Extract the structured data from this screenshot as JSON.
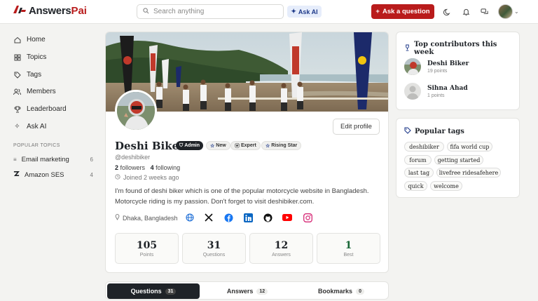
{
  "header": {
    "logo_text_1": "Answers",
    "logo_text_2": "Pai",
    "search_placeholder": "Search anything",
    "ask_ai_label": "Ask AI",
    "ask_question_label": "Ask a question",
    "ask_question_prefix": "+"
  },
  "sidebar": {
    "items": [
      {
        "label": "Home",
        "icon": "home-icon"
      },
      {
        "label": "Topics",
        "icon": "grid-icon"
      },
      {
        "label": "Tags",
        "icon": "tag-icon"
      },
      {
        "label": "Members",
        "icon": "users-icon"
      },
      {
        "label": "Leaderboard",
        "icon": "trophy-icon"
      },
      {
        "label": "Ask AI",
        "icon": "sparkle-icon"
      }
    ],
    "popular_title": "POPULAR TOPICS",
    "popular": [
      {
        "label": "Email marketing",
        "count": "6"
      },
      {
        "label": "Amazon SES",
        "count": "4"
      }
    ]
  },
  "profile": {
    "edit_label": "Edit profile",
    "name": "Deshi Biker",
    "badges": {
      "admin": "Admin",
      "new": "New",
      "expert": "Expert",
      "rising": "Rising Star"
    },
    "handle": "@deshibiker",
    "followers_count": "2",
    "followers_label": "followers",
    "following_count": "4",
    "following_label": "following",
    "joined": "Joined  2 weeks ago",
    "bio": "I'm found of deshi biker which is one of the popular motorcycle website in Bangladesh. Motorcycle riding is my passion. Don't forget to visit deshibiker.com.",
    "location": "Dhaka, Bangladesh",
    "social": [
      "globe-icon",
      "x-icon",
      "facebook-icon",
      "linkedin-icon",
      "github-icon",
      "youtube-icon",
      "instagram-icon"
    ],
    "stats": [
      {
        "value": "105",
        "label": "Points"
      },
      {
        "value": "31",
        "label": "Questions"
      },
      {
        "value": "12",
        "label": "Answers"
      },
      {
        "value": "1",
        "label": "Best"
      }
    ]
  },
  "tabs": [
    {
      "label": "Questions",
      "count": "31"
    },
    {
      "label": "Answers",
      "count": "12"
    },
    {
      "label": "Bookmarks",
      "count": "0"
    }
  ],
  "contributors": {
    "title": "Top contributors this week",
    "list": [
      {
        "name": "Deshi Biker",
        "points": "19 points"
      },
      {
        "name": "Sihna Ahad",
        "points": "1 points"
      }
    ]
  },
  "popular_tags": {
    "title": "Popular tags",
    "tags": [
      "deshibiker",
      "fifa world cup",
      "forum",
      "getting started",
      "last tag",
      "livefree ridesafehere",
      "quick",
      "welcome"
    ]
  },
  "colors": {
    "brand": "#b91c1c",
    "dark": "#1f2328",
    "best": "#166534",
    "accent": "#1f3a8a"
  }
}
